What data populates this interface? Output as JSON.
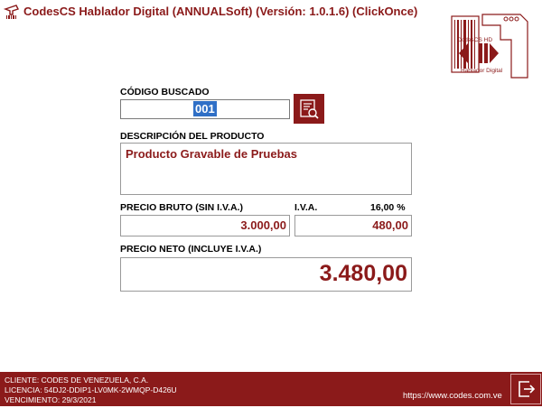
{
  "window": {
    "title": "CodesCS Hablador Digital (ANNUALSoft) (Versión: 1.0.1.6) (ClickOnce)"
  },
  "logo": {
    "line1": "CodesCS HD",
    "line2": "Hablador Digital"
  },
  "code_section": {
    "label": "CÓDIGO BUSCADO",
    "value": "001"
  },
  "description_section": {
    "label": "DESCRIPCIÓN DEL PRODUCTO",
    "value": "Producto Gravable de Pruebas"
  },
  "price_section": {
    "gross_label": "PRECIO BRUTO (SIN I.V.A.)",
    "gross_value": "3.000,00",
    "iva_label": "I.V.A.",
    "iva_rate": "16,00 %",
    "iva_value": "480,00"
  },
  "net_section": {
    "label": "PRECIO NETO (INCLUYE I.V.A.)",
    "value": "3.480,00"
  },
  "footer": {
    "client": "CLIENTE: CODES DE VENEZUELA, C.A.",
    "license": "LICENCIA: 54DJ2-DDIP1-LV0MK-2WMQP-D426U",
    "expiry": "VENCIMIENTO: 29/3/2021",
    "url": "https://www.codes.com.ve"
  },
  "colors": {
    "accent": "#8b1a1a",
    "selection": "#2f6fc6"
  },
  "icons": {
    "app": "barcode-scanner-icon",
    "search": "search-document-icon",
    "exit": "exit-icon"
  }
}
